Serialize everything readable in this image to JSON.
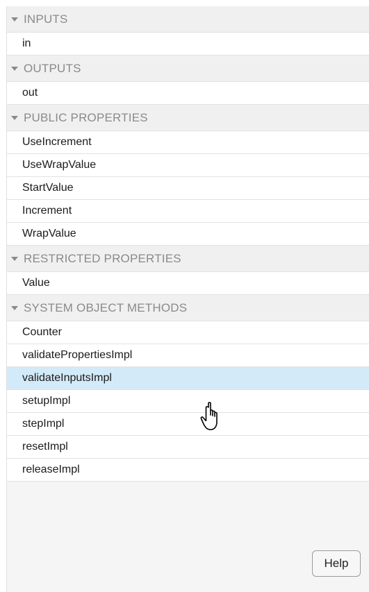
{
  "sections": [
    {
      "title": "INPUTS",
      "items": [
        "in"
      ]
    },
    {
      "title": "OUTPUTS",
      "items": [
        "out"
      ]
    },
    {
      "title": "PUBLIC PROPERTIES",
      "items": [
        "UseIncrement",
        "UseWrapValue",
        "StartValue",
        "Increment",
        "WrapValue"
      ]
    },
    {
      "title": "RESTRICTED PROPERTIES",
      "items": [
        "Value"
      ]
    },
    {
      "title": "SYSTEM OBJECT METHODS",
      "items": [
        "Counter",
        "validatePropertiesImpl",
        "validateInputsImpl",
        "setupImpl",
        "stepImpl",
        "resetImpl",
        "releaseImpl"
      ]
    }
  ],
  "selected_item": "validateInputsImpl",
  "help_label": "Help",
  "colors": {
    "selected_row": "#d3eaf8",
    "header_text": "#8a8a8a",
    "panel_bg": "#f5f5f5"
  }
}
